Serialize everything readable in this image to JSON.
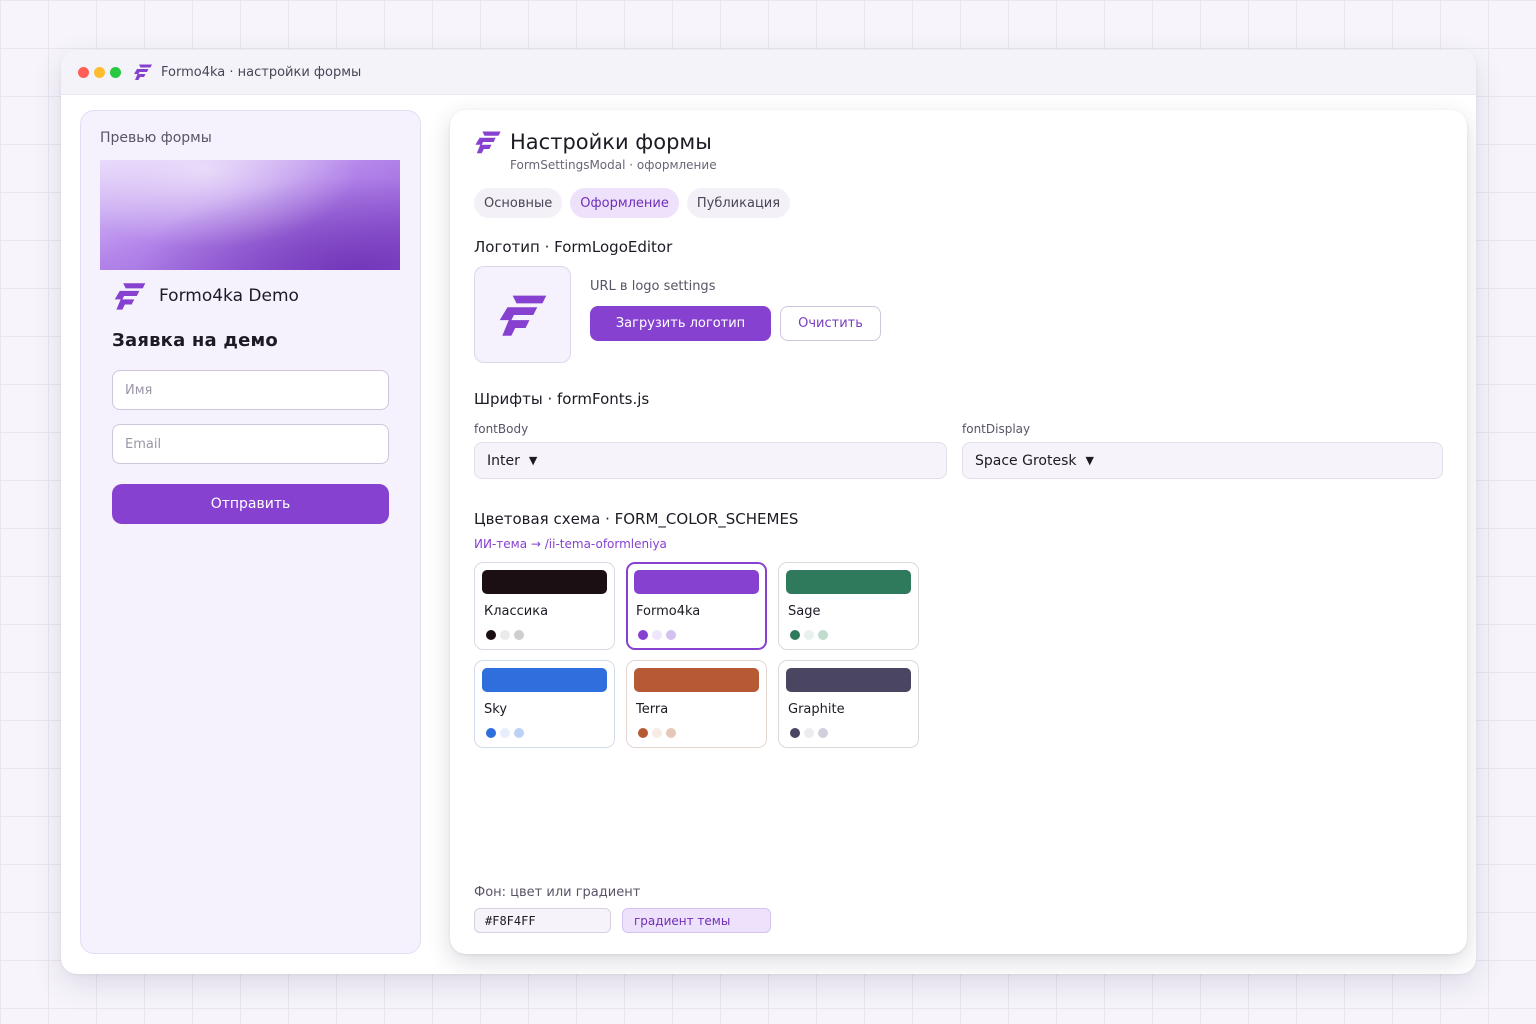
{
  "window": {
    "title": "Formo4ka · настройки формы"
  },
  "preview": {
    "label": "Превью формы",
    "brand_name": "Formo4ka Demo",
    "heading": "Заявка на демо",
    "name_placeholder": "Имя",
    "email_placeholder": "Email",
    "submit_label": "Отправить"
  },
  "modal": {
    "title": "Настройки формы",
    "subtitle": "FormSettingsModal · оформление",
    "tabs": [
      {
        "label": "Основные",
        "active": false
      },
      {
        "label": "Оформление",
        "active": true
      },
      {
        "label": "Публикация",
        "active": false
      }
    ],
    "logo": {
      "section_title": "Логотип · FormLogoEditor",
      "url_label": "URL в logo settings",
      "upload_label": "Загрузить логотип",
      "clear_label": "Очистить"
    },
    "fonts": {
      "section_title": "Шрифты · formFonts.js",
      "body_label": "fontBody",
      "body_value": "Inter",
      "display_label": "fontDisplay",
      "display_value": "Space Grotesk"
    },
    "colors": {
      "section_title": "Цветовая схема · FORM_COLOR_SCHEMES",
      "ai_link": "ИИ-тема → /ii-tema-oformleniya",
      "schemes": [
        {
          "name": "Классика",
          "selected": false,
          "primary": "#1c0f14",
          "dots": [
            "#1c0f14",
            "#ece9ec",
            "#d0cdd0"
          ],
          "border": "#ddd8e5"
        },
        {
          "name": "Formo4ka",
          "selected": true,
          "primary": "#8741d1",
          "dots": [
            "#8741d1",
            "#efe6fb",
            "#d2c0f0"
          ],
          "border": "#8741d1"
        },
        {
          "name": "Sage",
          "selected": false,
          "primary": "#2f7a5d",
          "dots": [
            "#2f7a5d",
            "#e8f2ed",
            "#bfdccf"
          ],
          "border": "#d7dcd9"
        },
        {
          "name": "Sky",
          "selected": false,
          "primary": "#2f6fdd",
          "dots": [
            "#2f6fdd",
            "#e6eefb",
            "#bcd2f4"
          ],
          "border": "#d3dcea"
        },
        {
          "name": "Terra",
          "selected": false,
          "primary": "#b65a36",
          "dots": [
            "#b65a36",
            "#f7ebe5",
            "#e6c6b7"
          ],
          "border": "#e2d7d1"
        },
        {
          "name": "Graphite",
          "selected": false,
          "primary": "#4a4560",
          "dots": [
            "#4a4560",
            "#ecebf0",
            "#d2cfdc"
          ],
          "border": "#dad8e0"
        }
      ]
    },
    "background": {
      "label": "Фон: цвет или градиент",
      "color_value": "#F8F4FF",
      "gradient_label": "градиент темы"
    }
  },
  "icons": {
    "brand": "formo4ka-logo-icon",
    "caret": "caret-down-icon"
  }
}
